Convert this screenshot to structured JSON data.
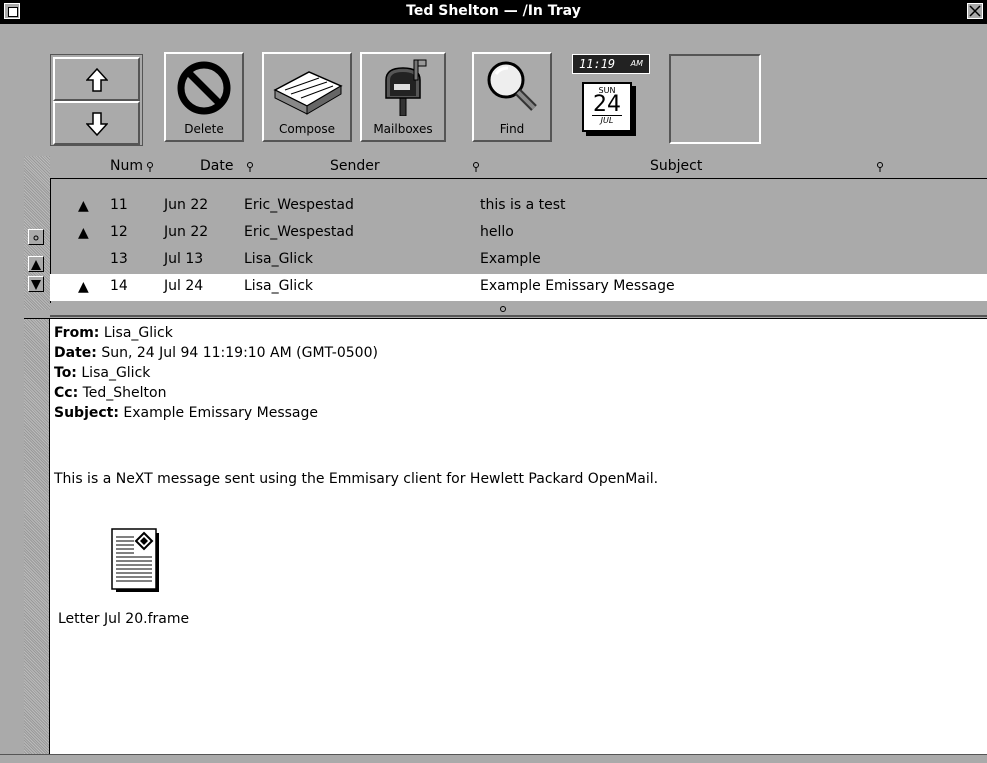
{
  "window": {
    "title": "Ted Shelton — /In Tray"
  },
  "toolbar": {
    "delete_label": "Delete",
    "compose_label": "Compose",
    "mailboxes_label": "Mailboxes",
    "find_label": "Find",
    "clock_time": "11:19",
    "clock_ampm": "AM",
    "calendar_dow": "SUN",
    "calendar_day": "24",
    "calendar_month": "JUL"
  },
  "list": {
    "columns": [
      "Num",
      "Date",
      "Sender",
      "Subject"
    ],
    "rows": [
      {
        "flag": "▲",
        "num": "11",
        "date": "Jun 22",
        "sender": "Eric_Wespestad",
        "subject": "this is a test"
      },
      {
        "flag": "▲",
        "num": "12",
        "date": "Jun 22",
        "sender": "Eric_Wespestad",
        "subject": "hello"
      },
      {
        "flag": "",
        "num": "13",
        "date": "Jul 13",
        "sender": "Lisa_Glick",
        "subject": "Example"
      },
      {
        "flag": "▲",
        "num": "14",
        "date": "Jul 24",
        "sender": "Lisa_Glick",
        "subject": "Example Emissary Message"
      }
    ],
    "selected_index": 3
  },
  "message": {
    "from_label": "From:",
    "from": "Lisa_Glick",
    "date_label": "Date:",
    "date": "Sun, 24 Jul 94 11:19:10 AM (GMT-0500)",
    "to_label": "To:",
    "to": "Lisa_Glick",
    "cc_label": "Cc:",
    "cc": "Ted_Shelton",
    "subject_label": "Subject:",
    "subject": "Example Emissary Message",
    "body": "This is a NeXT message sent using the Emmisary client for Hewlett Packard OpenMail.",
    "attachment_name": "Letter Jul 20.frame"
  },
  "icons": {
    "up": "up-arrow-icon",
    "down": "down-arrow-icon",
    "delete": "prohibited-icon",
    "compose": "envelope-icon",
    "mailboxes": "mailbox-icon",
    "find": "magnifier-icon",
    "attachment": "document-icon"
  }
}
